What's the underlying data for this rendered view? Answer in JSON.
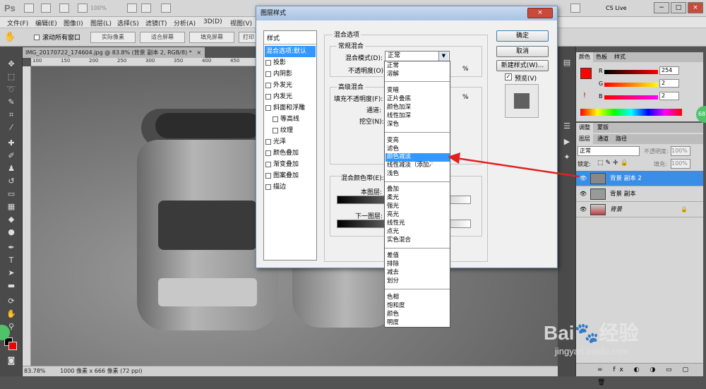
{
  "app": {
    "logo": "Ps",
    "zoom": "100%",
    "cs_live": "CS Live",
    "win_controls": [
      "−",
      "□",
      "×"
    ]
  },
  "menubar": [
    "文件(F)",
    "编辑(E)",
    "图像(I)",
    "图层(L)",
    "选择(S)",
    "滤镜(T)",
    "分析(A)",
    "3D(D)",
    "视图(V)"
  ],
  "options": {
    "scroll_all": "滚动所有窗口",
    "buttons": [
      "实际像素",
      "适合屏幕",
      "填充屏幕",
      "打印"
    ]
  },
  "document": {
    "tab_title": "IMG_20170722_174604.jpg @ 83.8% (背景 副本 2, RGB/8) *",
    "tab_close": "×",
    "ruler_labels": [
      "100",
      "150",
      "200",
      "250",
      "300",
      "350",
      "400",
      "450",
      "500",
      "550",
      "600",
      "650",
      "700",
      "750",
      "800",
      "850",
      "900",
      "950"
    ],
    "zoom": "83.78%",
    "status": "1000 像素 x 666 像素 (72 ppi)"
  },
  "dialog": {
    "title": "图层样式",
    "close": "×",
    "style_header": "样式",
    "styles": [
      {
        "label": "混合选项:默认",
        "checkbox": false,
        "selected": true
      },
      {
        "label": "投影",
        "checkbox": true
      },
      {
        "label": "内阴影",
        "checkbox": true
      },
      {
        "label": "外发光",
        "checkbox": true
      },
      {
        "label": "内发光",
        "checkbox": true
      },
      {
        "label": "斜面和浮雕",
        "checkbox": true
      },
      {
        "label": "等高线",
        "checkbox": true,
        "indent": true
      },
      {
        "label": "纹理",
        "checkbox": true,
        "indent": true
      },
      {
        "label": "光泽",
        "checkbox": true
      },
      {
        "label": "颜色叠加",
        "checkbox": true
      },
      {
        "label": "渐变叠加",
        "checkbox": true
      },
      {
        "label": "图案叠加",
        "checkbox": true
      },
      {
        "label": "描边",
        "checkbox": true
      }
    ],
    "blend_options_title": "混合选项",
    "general_blending": "常规混合",
    "blend_mode_label": "混合模式(D):",
    "blend_mode_value": "正常",
    "opacity_label": "不透明度(O):",
    "opacity_percent": "%",
    "advanced_blending": "高级混合",
    "fill_opacity_label": "填充不透明度(F):",
    "fill_percent": "%",
    "channels_label": "通道:",
    "knockout_label": "挖空(N):",
    "blend_if_label": "混合颜色带(E):",
    "this_layer": "本图层:",
    "underlying_layer": "下一图层:",
    "ok": "确定",
    "cancel": "取消",
    "new_style": "新建样式(W)...",
    "preview": "预览(V)",
    "preview_checked": "✓"
  },
  "dropdown": {
    "groups": [
      [
        "正常",
        "溶解"
      ],
      [
        "变暗",
        "正片叠底",
        "颜色加深",
        "线性加深",
        "深色"
      ],
      [
        "变亮",
        "滤色",
        "颜色减淡",
        "线性减淡（添加）",
        "浅色"
      ],
      [
        "叠加",
        "柔光",
        "强光",
        "亮光",
        "线性光",
        "点光",
        "实色混合"
      ],
      [
        "差值",
        "排除",
        "减去",
        "划分"
      ],
      [
        "色相",
        "饱和度",
        "颜色",
        "明度"
      ]
    ],
    "highlighted": "颜色减淡"
  },
  "color_panel": {
    "tabs": [
      "颜色",
      "色板",
      "样式"
    ],
    "channels": [
      {
        "label": "R",
        "value": "254"
      },
      {
        "label": "G",
        "value": "2"
      },
      {
        "label": "B",
        "value": "2"
      }
    ],
    "foreground_color": "#fe0202",
    "warning": "!"
  },
  "layers_panel": {
    "tabs": [
      "调整",
      "蒙版",
      "图层",
      "通道",
      "路径"
    ],
    "mode": "正常",
    "opacity_label": "不透明度:",
    "opacity_value": "100%",
    "lock_label": "锁定:",
    "fill_label": "填充:",
    "fill_value": "100%",
    "layers": [
      {
        "name": "背景 副本 2",
        "selected": true
      },
      {
        "name": "背景 副本",
        "selected": false
      },
      {
        "name": "背景",
        "selected": false,
        "italic": true,
        "locked": true
      }
    ]
  },
  "badge": "68",
  "watermark": {
    "brand": "Bai",
    "brand2": "经验",
    "url": "jingyan.baidu.com"
  }
}
